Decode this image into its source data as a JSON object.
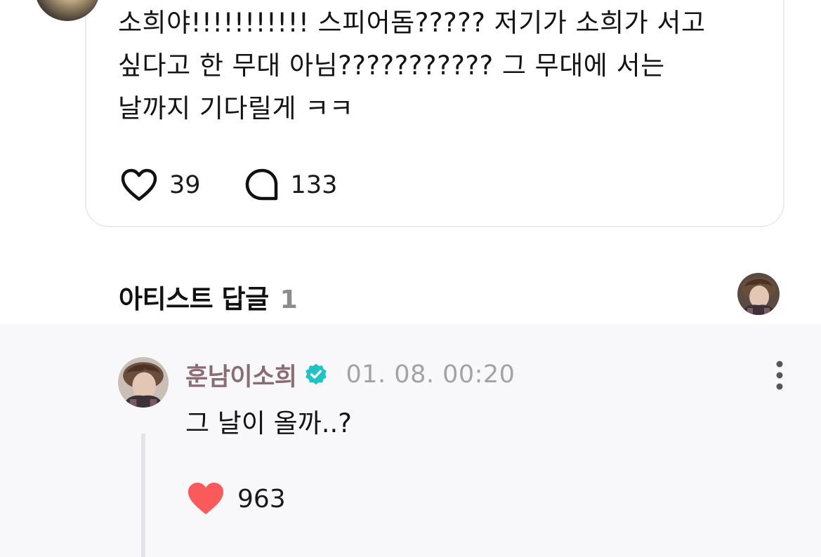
{
  "post": {
    "text": "소희야!!!!!!!!!!! 스피어돔????? 저기가 소희가 서고\n싶다고 한 무대 아님??????????? 그 무대에 서는\n날까지 기다릴게 ㅋㅋ",
    "like_icon": "heart-outline-icon",
    "like_count": "39",
    "comment_icon": "speech-bubble-icon",
    "comment_count": "133"
  },
  "artist_replies": {
    "title": "아티스트 답글",
    "count": "1"
  },
  "reply": {
    "author": "훈남이소희",
    "verified_icon": "verified-badge-icon",
    "verified_color": "#1ec4c4",
    "timestamp": "01. 08. 00:20",
    "text": "그 날이 올까..?",
    "like_icon": "heart-filled-icon",
    "like_color": "#fa5a5a",
    "like_count": "963",
    "more_icon": "more-vertical-icon"
  }
}
